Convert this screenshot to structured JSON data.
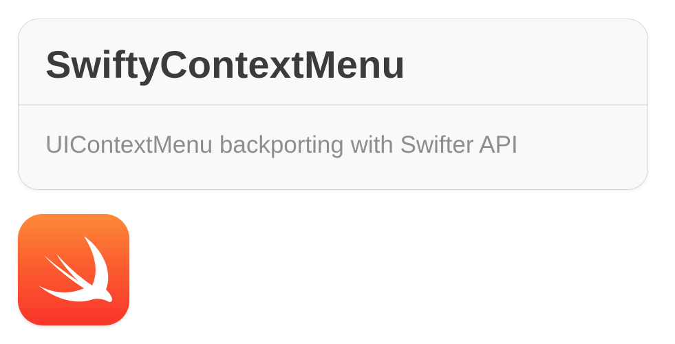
{
  "card": {
    "title": "SwiftyContextMenu",
    "subtitle": "UIContextMenu backporting with Swifter API"
  },
  "icon": {
    "name": "swift-logo-icon",
    "gradient_top": "#fd8a38",
    "gradient_bottom": "#f9352a",
    "glyph_color": "#ffffff"
  }
}
